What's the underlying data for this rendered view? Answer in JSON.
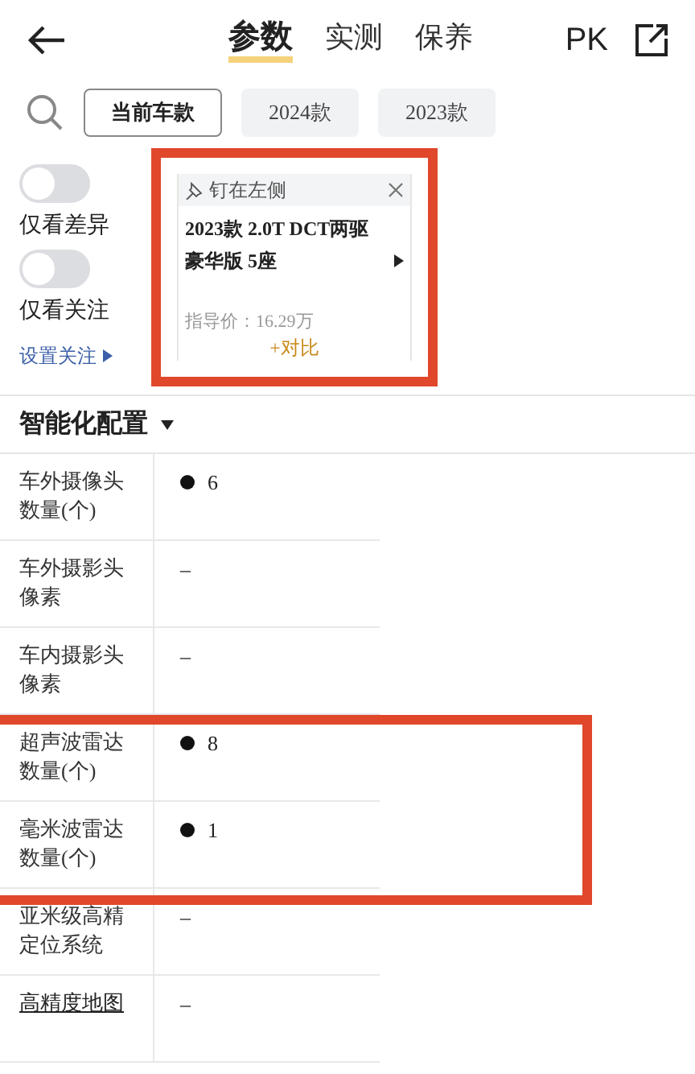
{
  "tabs": [
    {
      "label": "参数",
      "selected": true
    },
    {
      "label": "实测",
      "selected": false
    },
    {
      "label": "保养",
      "selected": false
    }
  ],
  "pk_label": "PK",
  "model_chips": [
    {
      "label": "当前车款",
      "selected": true
    },
    {
      "label": "2024款",
      "selected": false
    },
    {
      "label": "2023款",
      "selected": false
    }
  ],
  "filters": [
    {
      "label": "仅看差异",
      "on": false
    },
    {
      "label": "仅看关注",
      "on": false
    }
  ],
  "focus_link": "设置关注",
  "car_card": {
    "pin_label": "钉在左侧",
    "title": "2023款 2.0T DCT两驱豪华版 5座",
    "price": "指导价：16.29万",
    "compare": "+对比"
  },
  "section": {
    "title": "智能化配置",
    "expanded": true
  },
  "rows": [
    {
      "label": "车外摄像头数量(个)",
      "standard": true,
      "value": "6",
      "link": false
    },
    {
      "label": "车外摄影头像素",
      "standard": false,
      "value": "–",
      "link": false
    },
    {
      "label": "车内摄影头像素",
      "standard": false,
      "value": "–",
      "link": false
    },
    {
      "label": "超声波雷达数量(个)",
      "standard": true,
      "value": "8",
      "link": false
    },
    {
      "label": "毫米波雷达数量(个)",
      "standard": true,
      "value": "1",
      "link": false
    },
    {
      "label": "亚米级高精定位系统",
      "standard": false,
      "value": "–",
      "link": false
    },
    {
      "label": "高精度地图",
      "standard": false,
      "value": "–",
      "link": true
    }
  ]
}
